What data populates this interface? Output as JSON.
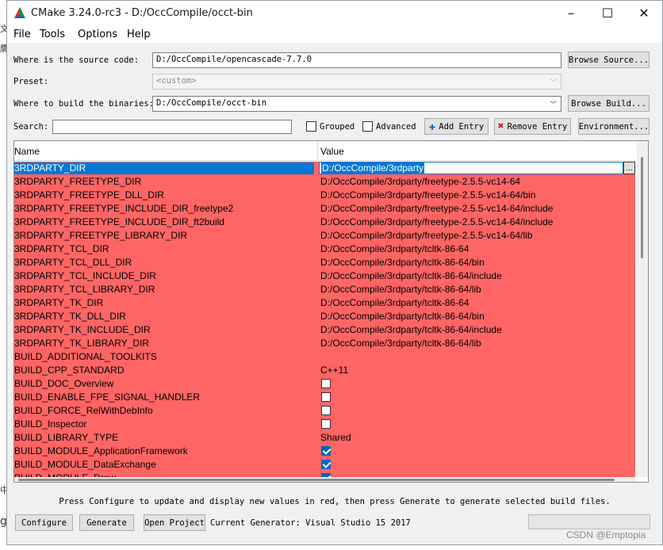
{
  "window": {
    "title": "CMake 3.24.0-rc3 - D:/OccCompile/occt-bin",
    "controls": {
      "minimize": "–",
      "maximize": "☐",
      "close": "✕"
    }
  },
  "menu": {
    "file": "File",
    "tools": "Tools",
    "options": "Options",
    "help": "Help"
  },
  "source": {
    "label": "Where is the source code:",
    "value": "D:/OccCompile/opencascade-7.7.0",
    "browse_label": "Browse Source..."
  },
  "preset": {
    "label": "Preset:",
    "value": "<custom>"
  },
  "binaries": {
    "label": "Where to build the binaries:",
    "value": "D:/OccCompile/occt-bin",
    "browse_label": "Browse Build..."
  },
  "search": {
    "label": "Search:",
    "value": ""
  },
  "options": {
    "grouped": "Grouped",
    "advanced": "Advanced"
  },
  "toolbar": {
    "add_entry": "Add Entry",
    "remove_entry": "Remove Entry",
    "environment": "Environment..."
  },
  "table": {
    "headers": {
      "name": "Name",
      "value": "Value"
    },
    "selected": {
      "name": "3RDPARTY_DIR",
      "value": "D:/OccCompile/3rdparty",
      "dots": "..."
    },
    "rows": [
      {
        "name": "3RDPARTY_FREETYPE_DIR",
        "value": "D:/OccCompile/3rdparty/freetype-2.5.5-vc14-64"
      },
      {
        "name": "3RDPARTY_FREETYPE_DLL_DIR",
        "value": "D:/OccCompile/3rdparty/freetype-2.5.5-vc14-64/bin"
      },
      {
        "name": "3RDPARTY_FREETYPE_INCLUDE_DIR_freetype2",
        "value": "D:/OccCompile/3rdparty/freetype-2.5.5-vc14-64/include"
      },
      {
        "name": "3RDPARTY_FREETYPE_INCLUDE_DIR_ft2build",
        "value": "D:/OccCompile/3rdparty/freetype-2.5.5-vc14-64/include"
      },
      {
        "name": "3RDPARTY_FREETYPE_LIBRARY_DIR",
        "value": "D:/OccCompile/3rdparty/freetype-2.5.5-vc14-64/lib"
      },
      {
        "name": "3RDPARTY_TCL_DIR",
        "value": "D:/OccCompile/3rdparty/tcltk-86-64"
      },
      {
        "name": "3RDPARTY_TCL_DLL_DIR",
        "value": "D:/OccCompile/3rdparty/tcltk-86-64/bin"
      },
      {
        "name": "3RDPARTY_TCL_INCLUDE_DIR",
        "value": "D:/OccCompile/3rdparty/tcltk-86-64/include"
      },
      {
        "name": "3RDPARTY_TCL_LIBRARY_DIR",
        "value": "D:/OccCompile/3rdparty/tcltk-86-64/lib"
      },
      {
        "name": "3RDPARTY_TK_DIR",
        "value": "D:/OccCompile/3rdparty/tcltk-86-64"
      },
      {
        "name": "3RDPARTY_TK_DLL_DIR",
        "value": "D:/OccCompile/3rdparty/tcltk-86-64/bin"
      },
      {
        "name": "3RDPARTY_TK_INCLUDE_DIR",
        "value": "D:/OccCompile/3rdparty/tcltk-86-64/include"
      },
      {
        "name": "3RDPARTY_TK_LIBRARY_DIR",
        "value": "D:/OccCompile/3rdparty/tcltk-86-64/lib"
      },
      {
        "name": "BUILD_ADDITIONAL_TOOLKITS",
        "value": ""
      },
      {
        "name": "BUILD_CPP_STANDARD",
        "value": "C++11"
      },
      {
        "name": "BUILD_DOC_Overview",
        "checkbox": false
      },
      {
        "name": "BUILD_ENABLE_FPE_SIGNAL_HANDLER",
        "checkbox": false
      },
      {
        "name": "BUILD_FORCE_RelWithDebInfo",
        "checkbox": false
      },
      {
        "name": "BUILD_Inspector",
        "checkbox": false
      },
      {
        "name": "BUILD_LIBRARY_TYPE",
        "value": "Shared"
      },
      {
        "name": "BUILD_MODULE_ApplicationFramework",
        "checkbox": true
      },
      {
        "name": "BUILD_MODULE_DataExchange",
        "checkbox": true
      },
      {
        "name": "BUILD_MODULE_Draw",
        "checkbox": true
      }
    ]
  },
  "status": "Press Configure to update and display new values in red, then press Generate to generate selected build files.",
  "bottom": {
    "configure": "Configure",
    "generate": "Generate",
    "open_project": "Open Project",
    "generator": "Current Generator: Visual Studio 15 2017"
  },
  "watermark": "CSDN @Emptopia",
  "background_fragments": [
    "文",
    "贋",
    "中",
    "g"
  ],
  "colors": {
    "changed_row": "#ff6565",
    "selection": "#0078d7",
    "checkbox_on": "#0067c0"
  }
}
